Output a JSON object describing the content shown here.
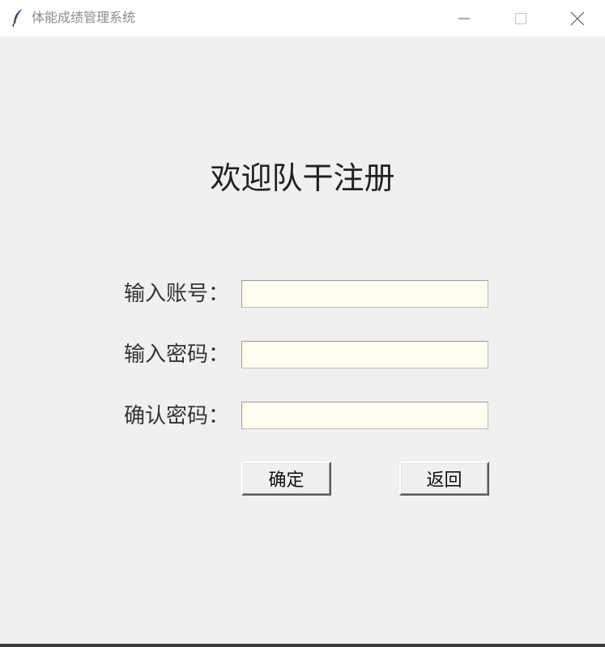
{
  "window": {
    "title": "体能成绩管理系统",
    "icons": {
      "app": "feather-icon",
      "minimize": "minimize-icon",
      "maximize": "maximize-icon",
      "close": "close-icon"
    }
  },
  "form": {
    "heading": "欢迎队干注册",
    "fields": [
      {
        "label": "输入账号：",
        "value": ""
      },
      {
        "label": "输入密码：",
        "value": ""
      },
      {
        "label": "确认密码：",
        "value": ""
      }
    ],
    "confirm_label": "确定",
    "back_label": "返回"
  },
  "colors": {
    "background": "#f0f0f0",
    "titlebar": "#ffffff",
    "input_background": "#fffff0"
  }
}
